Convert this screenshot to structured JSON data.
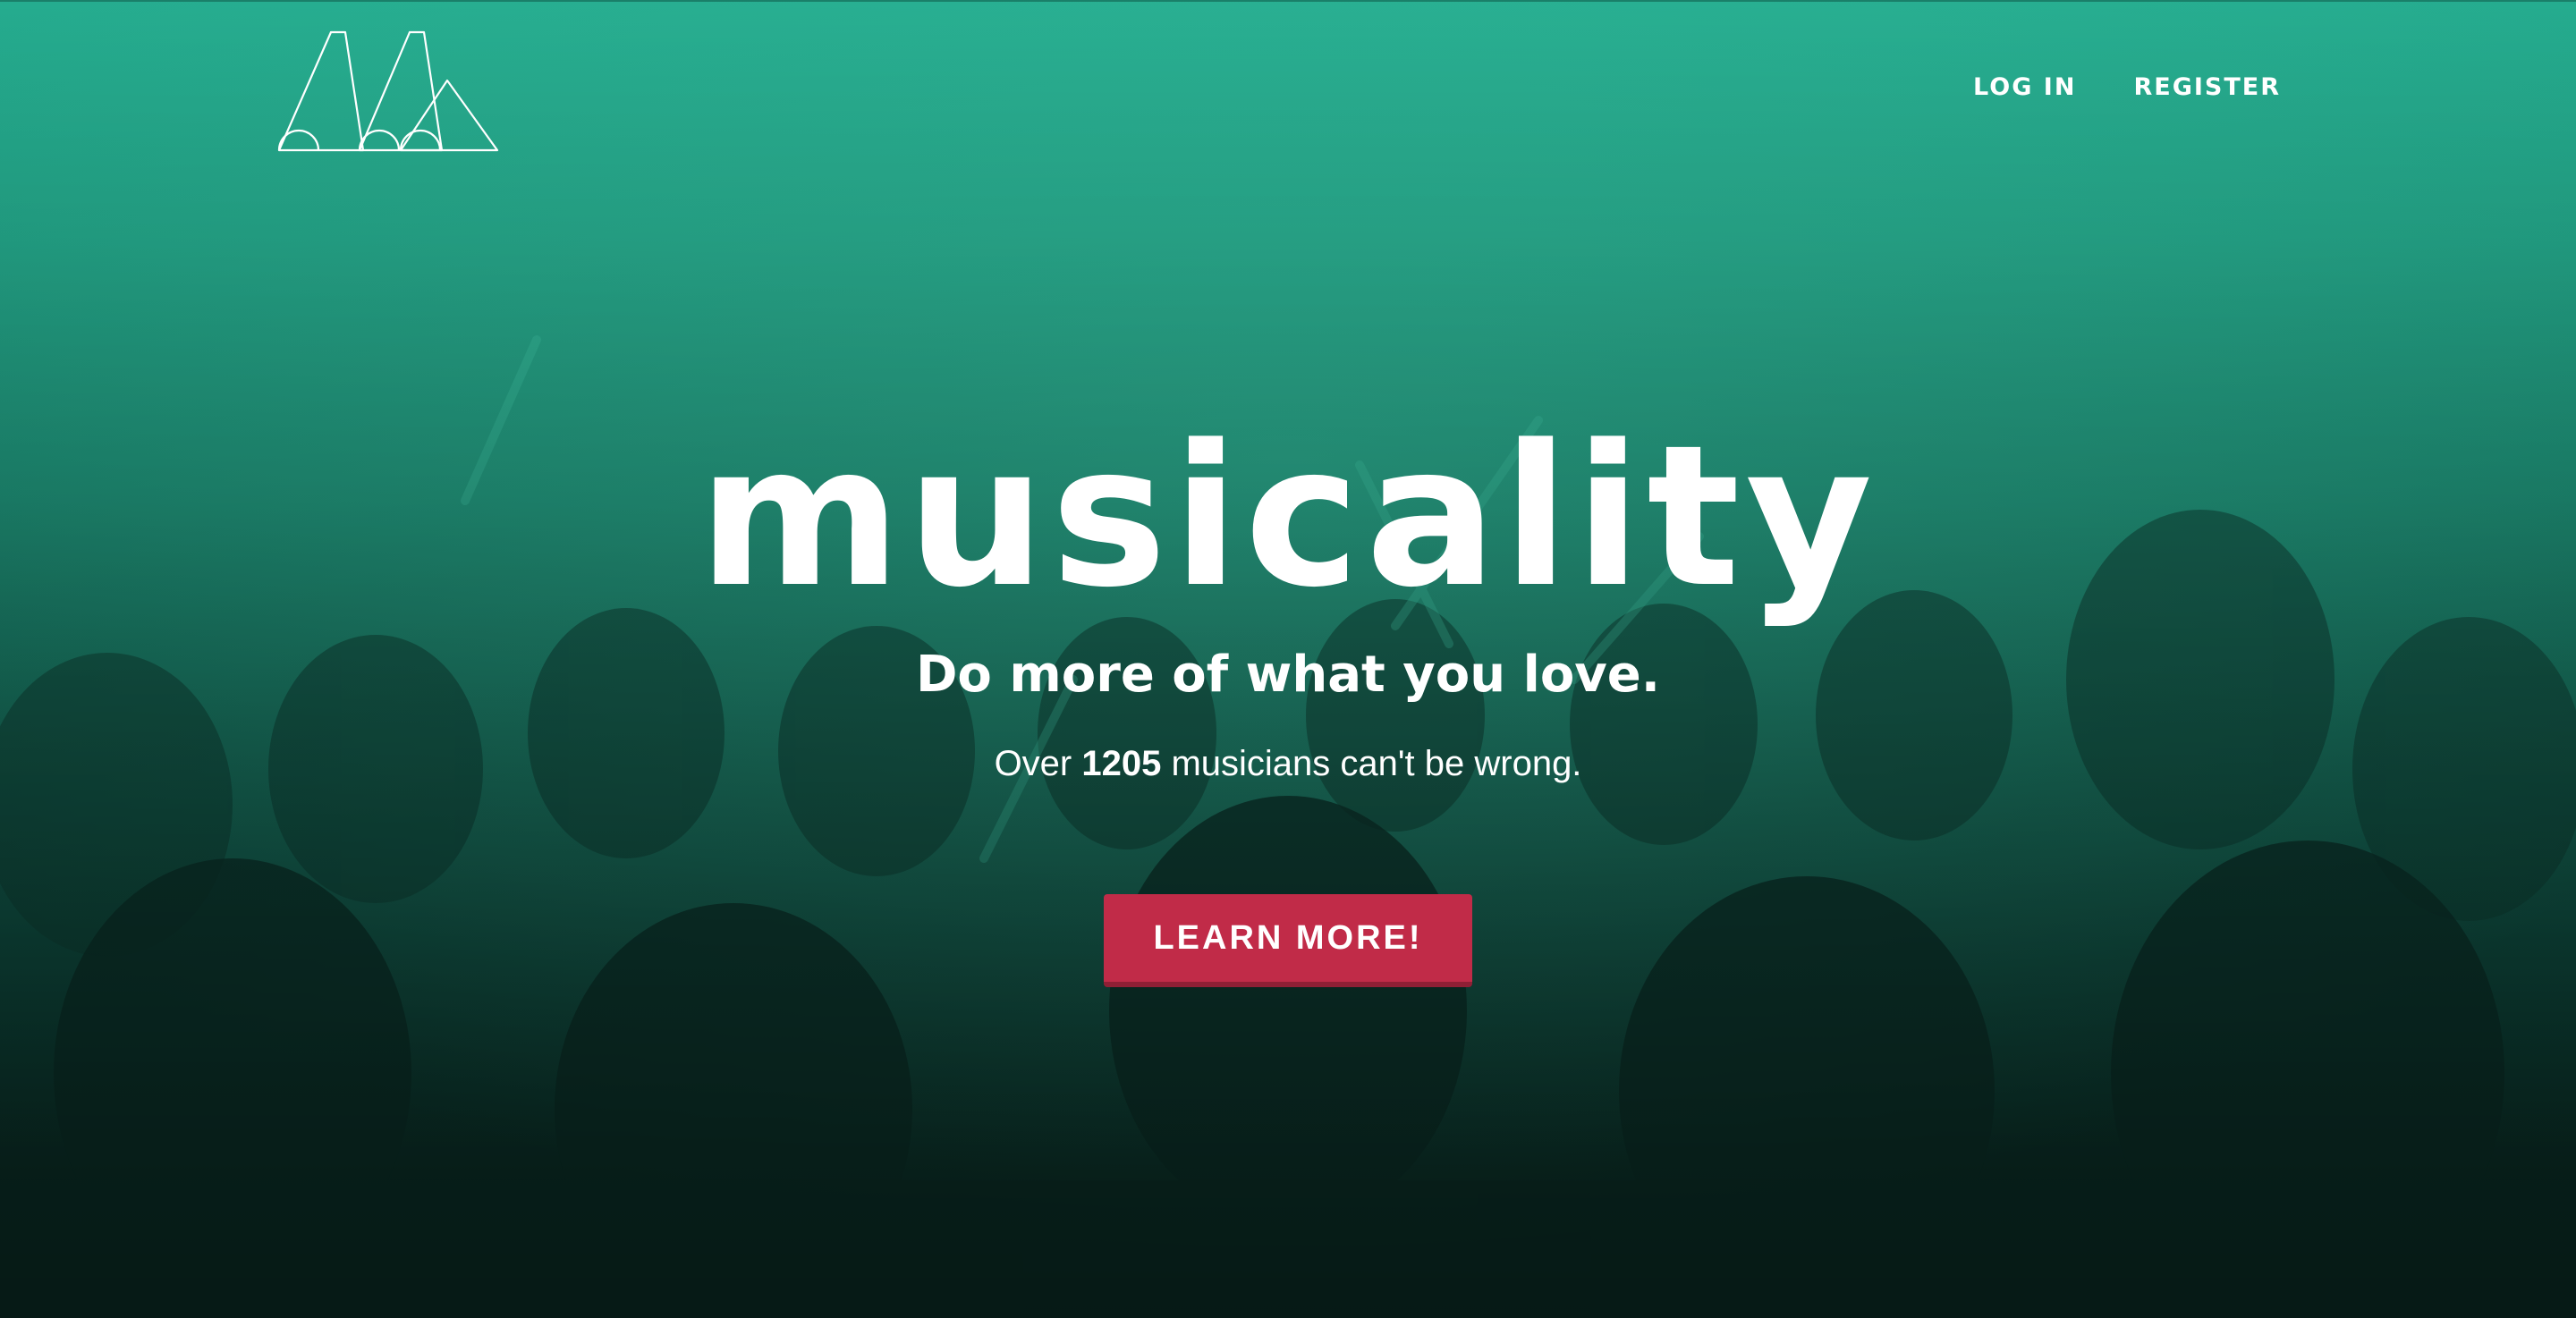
{
  "nav": {
    "login_label": "LOG IN",
    "register_label": "REGISTER"
  },
  "hero": {
    "brand": "musicality",
    "tagline": "Do more of what you love.",
    "subline_prefix": "Over ",
    "musician_count": "1205",
    "subline_suffix": " musicians can't be wrong.",
    "cta_label": "LEARN MORE!"
  },
  "icons": {
    "logo": "mountain-music-logo-icon"
  },
  "colors": {
    "overlay": "#25ac8f",
    "cta": "#c12b48",
    "text": "#ffffff"
  }
}
